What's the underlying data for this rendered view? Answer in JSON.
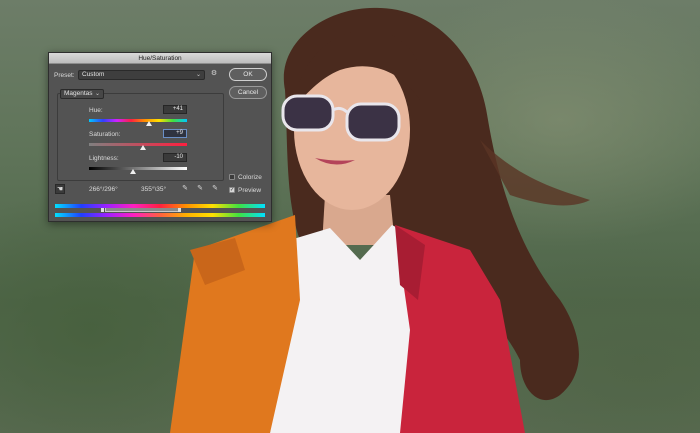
{
  "dialog": {
    "title": "Hue/Saturation",
    "preset_label": "Preset:",
    "preset_value": "Custom",
    "ok_label": "OK",
    "cancel_label": "Cancel",
    "channel_value": "Magentas",
    "hue": {
      "label": "Hue:",
      "value": "+41",
      "fraction": 0.61
    },
    "saturation": {
      "label": "Saturation:",
      "value": "+9",
      "fraction": 0.55
    },
    "lightness": {
      "label": "Lightness:",
      "value": "-10",
      "fraction": 0.45
    },
    "colorize_label": "Colorize",
    "colorize_checked": false,
    "preview_label": "Preview",
    "preview_checked": true,
    "range_left": "266°/296°",
    "range_right": "355°\\35°"
  },
  "icons": {
    "gear": "gear-icon",
    "hand": "targeted-adjustment-icon",
    "eyedropper": "eyedropper-icon",
    "eyedropper_plus": "eyedropper-plus-icon",
    "eyedropper_minus": "eyedropper-minus-icon",
    "chevron": "chevron-down-icon"
  },
  "colors": {
    "dialog_bg": "#535353",
    "title_bg": "#cfcfcf",
    "focus_border": "#6a8fc7"
  }
}
